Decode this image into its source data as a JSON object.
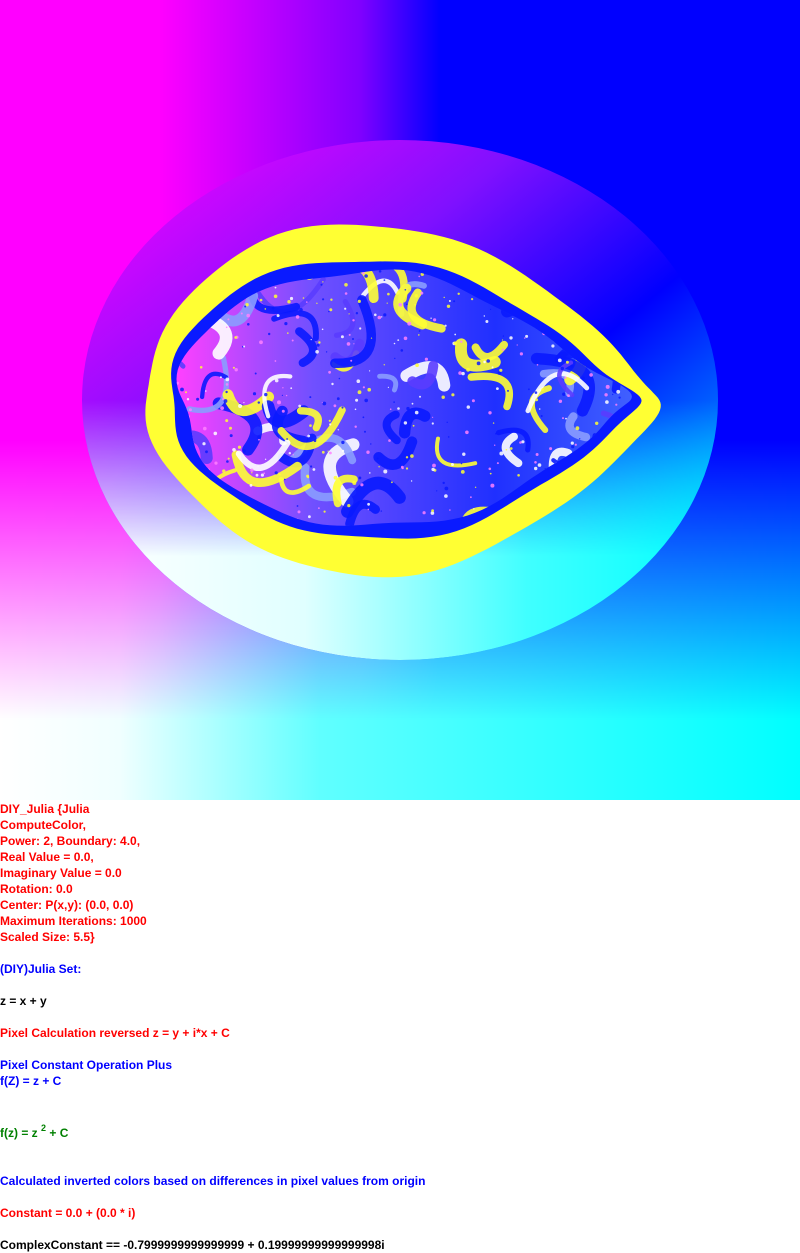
{
  "image": {
    "description": "fractal render",
    "colors": {
      "magenta": "#ff00ff",
      "blue": "#0000ff",
      "cyan": "#00ffff",
      "white": "#ffffff",
      "yellow": "#ffff33",
      "deep_blue": "#0a1aff",
      "light_blue": "#8a9cff"
    }
  },
  "params": {
    "line1": "DIY_Julia {Julia",
    "line2": "ComputeColor,",
    "line3": "Power: 2, Boundary: 4.0,",
    "line4": "Real Value = 0.0,",
    "line5": "Imaginary Value = 0.0",
    "line6": "Rotation: 0.0",
    "line7": "Center: P(x,y): (0.0, 0.0)",
    "line8": "Maximum Iterations: 1000",
    "line9": "Scaled Size: 5.5}"
  },
  "set_title": "(DIY)Julia Set:",
  "z_def": "z = x + y",
  "pixel_calc": "Pixel Calculation reversed z = y + i*x + C",
  "pixel_const_op": "Pixel Constant Operation Plus",
  "fz_def": "f(Z) = z + C",
  "formula": {
    "prefix": "f(z) = z ",
    "power": "2",
    "suffix": " + C"
  },
  "colors_note": "Calculated inverted colors based on differences in pixel values from origin",
  "constant": "Constant = 0.0 + (0.0 * i)",
  "complex_constant": "ComplexConstant == -0.7999999999999999 + 0.19999999999999998i"
}
